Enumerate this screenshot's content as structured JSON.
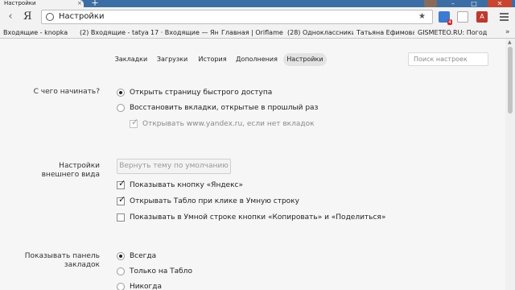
{
  "tab": {
    "title": "Настройки",
    "close": "×",
    "new_tab": "+"
  },
  "window_controls": {
    "minimize": "–",
    "maximize": "□",
    "close": "✕"
  },
  "toolbar": {
    "back_icon": "‹",
    "logo": "Я",
    "address": "Настройки",
    "star_icon": "★",
    "extension_badge": "4",
    "pdf_label": "A"
  },
  "bookmarks": [
    "Входящие - knopka",
    "(2) Входящие - tatya",
    "17 · Входящие — Ян",
    "Главная | Oriflame",
    "(28) Одноклассники",
    "Татьяна Ефимова",
    "GISMETEO.RU: Погод"
  ],
  "bookmarks_more": "»",
  "nav_tabs": [
    "Закладки",
    "Загрузки",
    "История",
    "Дополнения",
    "Настройки"
  ],
  "search": {
    "placeholder": "Поиск настроек"
  },
  "sections": {
    "startup": {
      "label": "С чего начинать?",
      "option_speed_dial": "Открыть страницу быстрого доступа",
      "option_restore": "Восстановить вкладки, открытые в прошлый раз",
      "sub_open_yandex": "Открывать www.yandex.ru, если нет вкладок"
    },
    "appearance": {
      "label": "Настройки внешнего вида",
      "reset_theme": "Вернуть тему по умолчанию",
      "show_yandex_button": "Показывать кнопку «Яндекс»",
      "open_tablo": "Открывать Табло при клике в Умную строку",
      "copy_share_buttons": "Показывать в Умной строке кнопки «Копировать» и «Поделиться»"
    },
    "bookmarks_bar": {
      "label": "Показывать панель закладок",
      "always": "Всегда",
      "only_tablo": "Только на Табло",
      "never": "Никогда"
    }
  },
  "colors": {
    "titlebar": "#3a6ea5",
    "toolbar": "#f2f2f2",
    "page": "#f6f6f6"
  }
}
